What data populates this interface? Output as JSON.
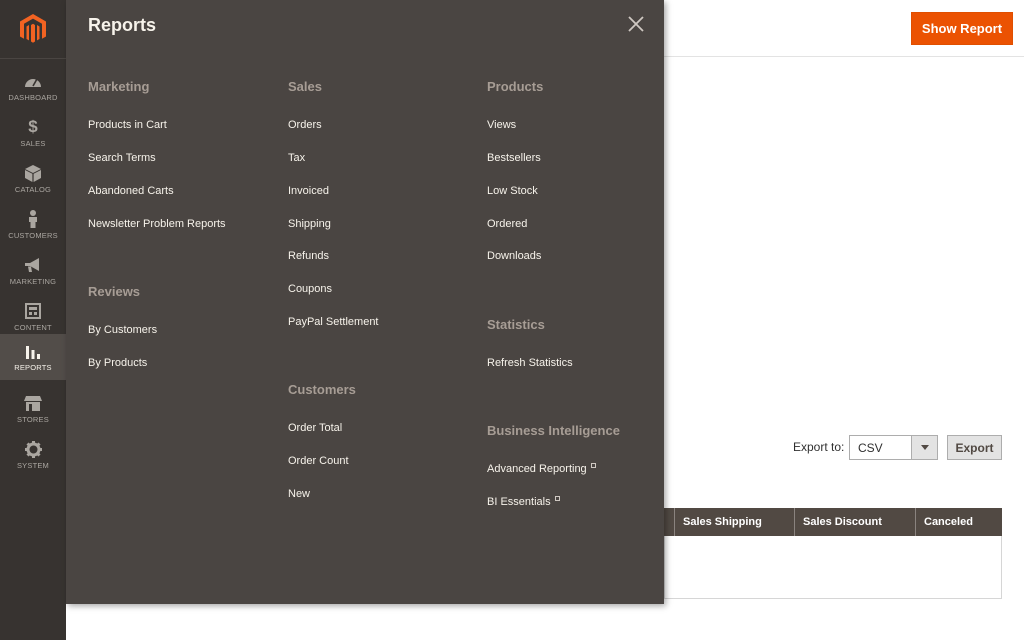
{
  "sidebar": {
    "items": [
      {
        "label": "DASHBOARD",
        "icon": "dashboard-icon"
      },
      {
        "label": "SALES",
        "icon": "dollar-icon"
      },
      {
        "label": "CATALOG",
        "icon": "cube-icon"
      },
      {
        "label": "CUSTOMERS",
        "icon": "person-icon"
      },
      {
        "label": "MARKETING",
        "icon": "megaphone-icon"
      },
      {
        "label": "CONTENT",
        "icon": "layout-icon"
      },
      {
        "label": "REPORTS",
        "icon": "bar-chart-icon"
      },
      {
        "label": "STORES",
        "icon": "store-icon"
      },
      {
        "label": "SYSTEM",
        "icon": "gear-icon"
      }
    ],
    "active": "REPORTS"
  },
  "header": {
    "show_report_label": "Show Report"
  },
  "export": {
    "label": "Export to:",
    "format": "CSV",
    "button_label": "Export"
  },
  "grid": {
    "columns": [
      "Sales Shipping",
      "Sales Discount",
      "Canceled"
    ]
  },
  "menu": {
    "title": "Reports",
    "groups": {
      "marketing": {
        "title": "Marketing",
        "links": [
          "Products in Cart",
          "Search Terms",
          "Abandoned Carts",
          "Newsletter Problem Reports"
        ]
      },
      "reviews": {
        "title": "Reviews",
        "links": [
          "By Customers",
          "By Products"
        ]
      },
      "sales": {
        "title": "Sales",
        "links": [
          "Orders",
          "Tax",
          "Invoiced",
          "Shipping",
          "Refunds",
          "Coupons",
          "PayPal Settlement"
        ]
      },
      "customers": {
        "title": "Customers",
        "links": [
          "Order Total",
          "Order Count",
          "New"
        ]
      },
      "products": {
        "title": "Products",
        "links": [
          "Views",
          "Bestsellers",
          "Low Stock",
          "Ordered",
          "Downloads"
        ]
      },
      "statistics": {
        "title": "Statistics",
        "links": [
          "Refresh Statistics"
        ]
      },
      "bi": {
        "title": "Business Intelligence",
        "links": [
          "Advanced Reporting",
          "BI Essentials"
        ]
      }
    }
  },
  "colors": {
    "accent": "#eb5202",
    "sidebar_bg": "#373330",
    "menu_bg": "#4a4542",
    "grid_header": "#514943"
  }
}
